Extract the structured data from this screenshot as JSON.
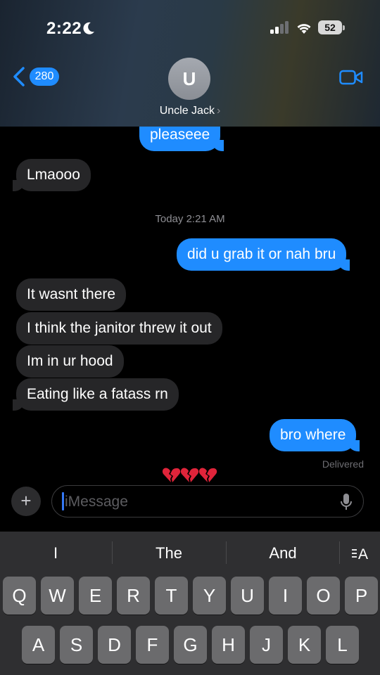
{
  "status_bar": {
    "time": "2:22",
    "battery": "52"
  },
  "header": {
    "back_count": "280",
    "avatar_initial": "U",
    "contact_name": "Uncle Jack",
    "contact_chevron": "›"
  },
  "thread": {
    "msg_top_partial": "pleaseee",
    "msg_lmaooo": "Lmaooo",
    "timestamp": "Today 2:21 AM",
    "msg_grab": "did u grab it or nah bru",
    "msg_wasnt": "It wasnt there",
    "msg_janitor": "I think the janitor threw it out",
    "msg_hood": "Im in ur hood",
    "msg_eating": "Eating like a fatass rn",
    "msg_where": "bro where",
    "delivered": "Delivered",
    "reaction": "💔💔💔"
  },
  "composer": {
    "plus_label": "+",
    "placeholder": "iMessage"
  },
  "keyboard": {
    "suggestions": [
      "I",
      "The",
      "And"
    ],
    "row1": [
      "Q",
      "W",
      "E",
      "R",
      "T",
      "Y",
      "U",
      "I",
      "O",
      "P"
    ],
    "row2": [
      "A",
      "S",
      "D",
      "F",
      "G",
      "H",
      "J",
      "K",
      "L"
    ]
  },
  "colors": {
    "outgoing_bubble": "#1f8cff",
    "incoming_bubble": "#262628",
    "accent": "#1f8cff",
    "keyboard_bg": "#2f2f31",
    "key_bg": "#6b6b6d"
  },
  "icons": [
    "moon-icon",
    "signal-icon",
    "wifi-icon",
    "battery-icon",
    "back-icon",
    "video-call-icon",
    "mic-icon",
    "text-format-icon",
    "broken-heart-icon"
  ]
}
